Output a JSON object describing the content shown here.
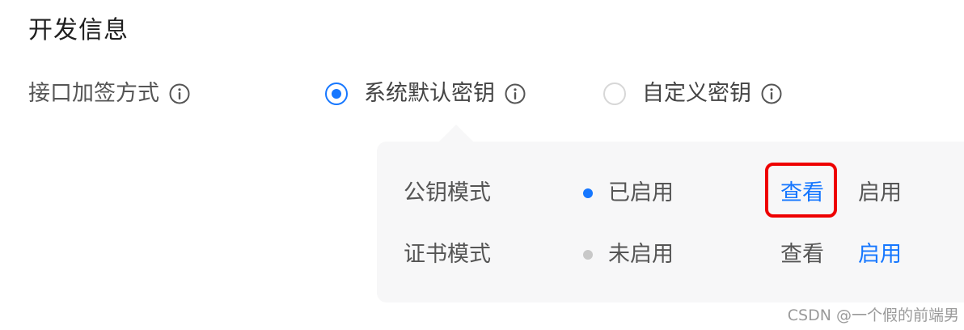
{
  "section": {
    "title": "开发信息"
  },
  "sign_method": {
    "label": "接口加签方式",
    "label_icon": "info-icon",
    "options": [
      {
        "label": "系统默认密钥",
        "checked": true,
        "icon": "info-icon"
      },
      {
        "label": "自定义密钥",
        "checked": false,
        "icon": "info-icon"
      }
    ]
  },
  "key_modes": {
    "rows": [
      {
        "name": "公钥模式",
        "status": "已启用",
        "status_color": "#1677ff",
        "view_label": "查看",
        "view_color": "#1677ff",
        "enable_label": "启用",
        "enable_color": "#555555"
      },
      {
        "name": "证书模式",
        "status": "未启用",
        "status_color": "#c8c8c8",
        "view_label": "查看",
        "view_color": "#555555",
        "enable_label": "启用",
        "enable_color": "#1677ff"
      }
    ]
  },
  "colors": {
    "accent": "#1677ff",
    "highlight": "#ee0000",
    "panel_bg": "#f7f7f8"
  },
  "watermark": "CSDN @一个假的前端男"
}
